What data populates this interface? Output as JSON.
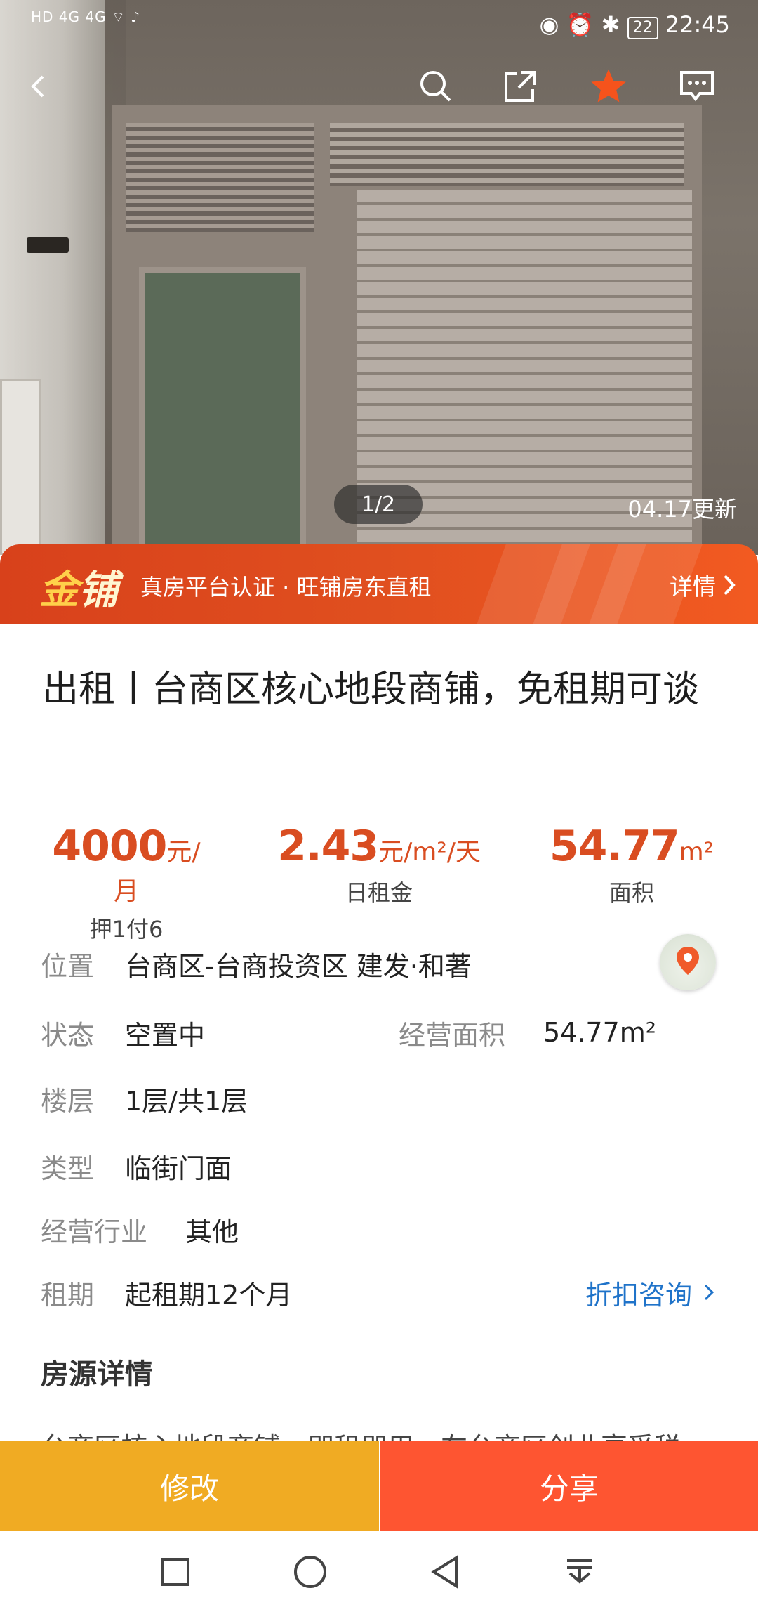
{
  "status_bar": {
    "left": "HD 4G 4G",
    "time": "22:45",
    "battery": "22"
  },
  "gallery": {
    "counter": "1/2",
    "updated": "04.17更新"
  },
  "banner": {
    "logo_a": "金",
    "logo_b": "铺",
    "text": "真房平台认证 · 旺铺房东直租",
    "detail": "详情"
  },
  "listing": {
    "title": "出租丨台商区核心地段商铺，免租期可谈",
    "rent": {
      "value": "4000",
      "unit": "元/月",
      "sub": "押1付6"
    },
    "daily": {
      "value": "2.43",
      "unit": "元/m²/天",
      "sub": "日租金"
    },
    "area": {
      "value": "54.77",
      "unit": "m²",
      "sub": "面积"
    }
  },
  "details": {
    "location_label": "位置",
    "location_value": "台商区-台商投资区 建发·和著",
    "status_label": "状态",
    "status_value": "空置中",
    "op_area_label": "经营面积",
    "op_area_value": "54.77m²",
    "floor_label": "楼层",
    "floor_value": "1层/共1层",
    "type_label": "类型",
    "type_value": "临街门面",
    "industry_label": "经营行业",
    "industry_value": "其他",
    "lease_label": "租期",
    "lease_value": "起租期12个月",
    "consult": "折扣咨询"
  },
  "section_title": "房源详情",
  "section_preview": "台商区核心地段商铺，即租即用，在台商区创业享受税",
  "actions": {
    "edit": "修改",
    "share": "分享"
  },
  "colors": {
    "accent": "#d94d21",
    "edit": "#f0ab23",
    "share": "#fe5531",
    "link": "#1f73c9"
  }
}
